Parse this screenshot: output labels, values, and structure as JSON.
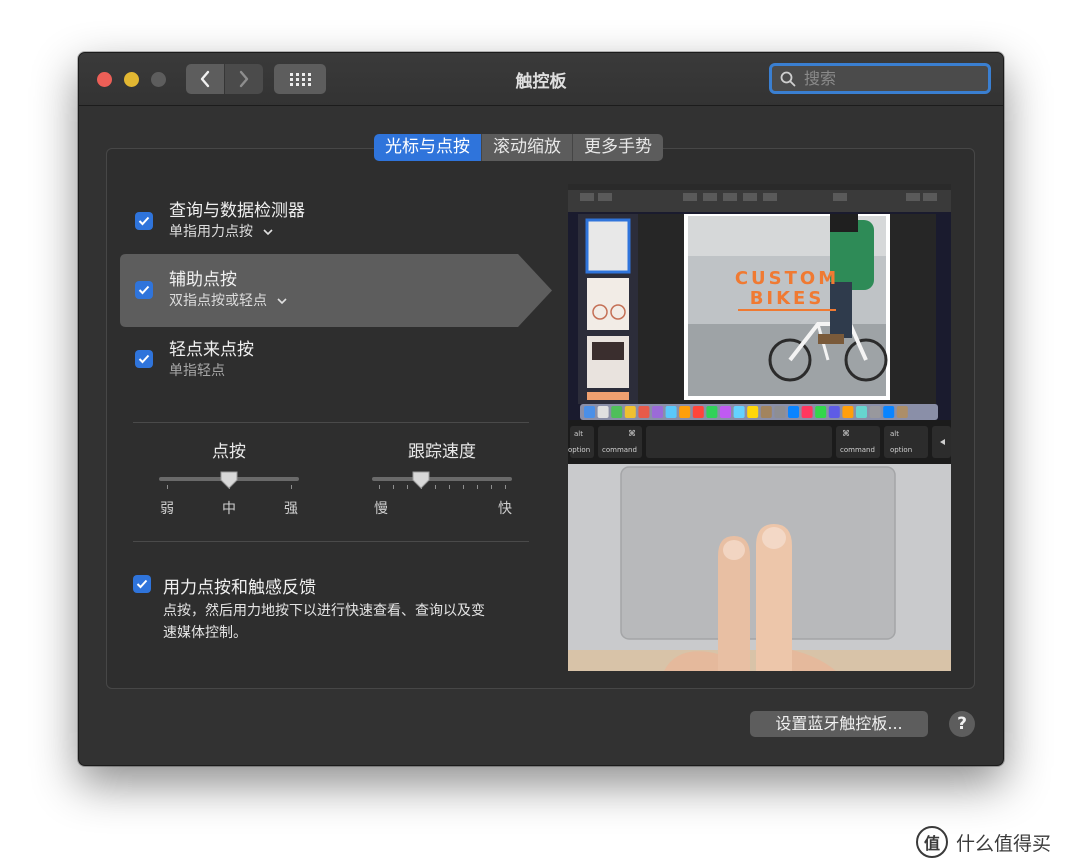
{
  "window": {
    "title": "触控板",
    "search_placeholder": "搜索"
  },
  "tabs": [
    {
      "label": "光标与点按",
      "active": true
    },
    {
      "label": "滚动缩放",
      "active": false
    },
    {
      "label": "更多手势",
      "active": false
    }
  ],
  "options": [
    {
      "label": "查询与数据检测器",
      "sub": "单指用力点按",
      "checked": true,
      "has_dropdown": true
    },
    {
      "label": "辅助点按",
      "sub": "双指点按或轻点",
      "checked": true,
      "has_dropdown": true,
      "selected": true
    },
    {
      "label": "轻点来点按",
      "sub": "单指轻点",
      "checked": true,
      "has_dropdown": false
    }
  ],
  "sliders": {
    "click": {
      "title": "点按",
      "min_label": "弱",
      "mid_label": "中",
      "max_label": "强",
      "value_fraction": 0.5
    },
    "tracking": {
      "title": "跟踪速度",
      "min_label": "慢",
      "max_label": "快",
      "value_fraction": 0.35
    }
  },
  "force_click": {
    "label": "用力点按和触感反馈",
    "checked": true,
    "description_line1": "点按，然后用力地按下以进行快速查看、查询以及变",
    "description_line2": "速媒体控制。"
  },
  "preview": {
    "poster_line1": "CUSTOM",
    "poster_line2": "BIKES",
    "key_alt_left": "alt",
    "key_option_left": "option",
    "key_cmd_symbol": "⌘",
    "key_command": "command",
    "key_alt_right": "alt",
    "key_option_right": "option"
  },
  "buttons": {
    "bluetooth": "设置蓝牙触控板...",
    "help": "?"
  },
  "watermark": {
    "logo_text": "值",
    "text": "什么值得买"
  },
  "colors": {
    "accent": "#2f74db",
    "window_bg": "#323232",
    "close": "#ec5f57",
    "minimize": "#e2b732"
  }
}
